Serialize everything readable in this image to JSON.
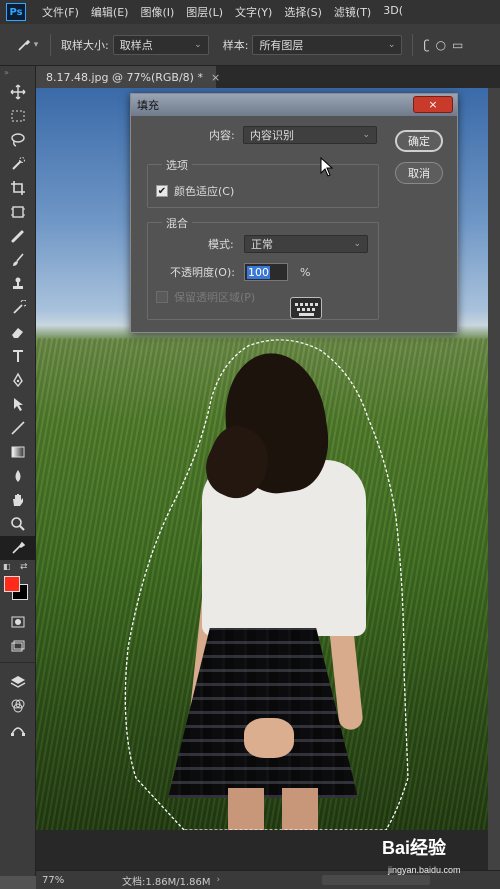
{
  "app": {
    "logo_text": "Ps"
  },
  "menu": {
    "items": [
      "文件(F)",
      "编辑(E)",
      "图像(I)",
      "图层(L)",
      "文字(Y)",
      "选择(S)",
      "滤镜(T)",
      "3D("
    ]
  },
  "options_bar": {
    "sample_size_label": "取样大小:",
    "sample_size_value": "取样点",
    "sample_label": "样本:",
    "sample_value": "所有图层"
  },
  "document_tab": {
    "title": "8.17.48.jpg @ 77%(RGB/8) *",
    "close": "×"
  },
  "toolbar": {
    "tools": [
      "move-icon",
      "marquee-icon",
      "lasso-icon",
      "quick-select-icon",
      "crop-icon",
      "frame-icon",
      "eyedropper-icon",
      "healing-brush-icon",
      "brush-icon",
      "stamp-icon",
      "history-brush-icon",
      "eraser-icon",
      "gradient-icon",
      "blur-icon",
      "dodge-icon",
      "pen-icon",
      "type-icon",
      "path-select-icon",
      "rectangle-icon",
      "hand-icon",
      "zoom-icon"
    ],
    "foreground_color": "#ff2a1a",
    "background_color": "#000000"
  },
  "dialog": {
    "title": "填充",
    "close": "×",
    "content_label": "内容:",
    "content_value": "内容识别",
    "ok_button": "确定",
    "cancel_button": "取消",
    "options_group": "选项",
    "color_adapt_label": "颜色适应(C)",
    "color_adapt_checked": true,
    "blend_group": "混合",
    "mode_label": "模式:",
    "mode_value": "正常",
    "opacity_label": "不透明度(O):",
    "opacity_value": "100",
    "opacity_unit": "%",
    "preserve_transparency_label": "保留透明区域(P)"
  },
  "status_bar": {
    "zoom": "77%",
    "doc_info": "文档:1.86M/1.86M",
    "arrow": "›"
  },
  "watermark": {
    "logo": "Bai经验",
    "url": "jingyan.baidu.com"
  }
}
